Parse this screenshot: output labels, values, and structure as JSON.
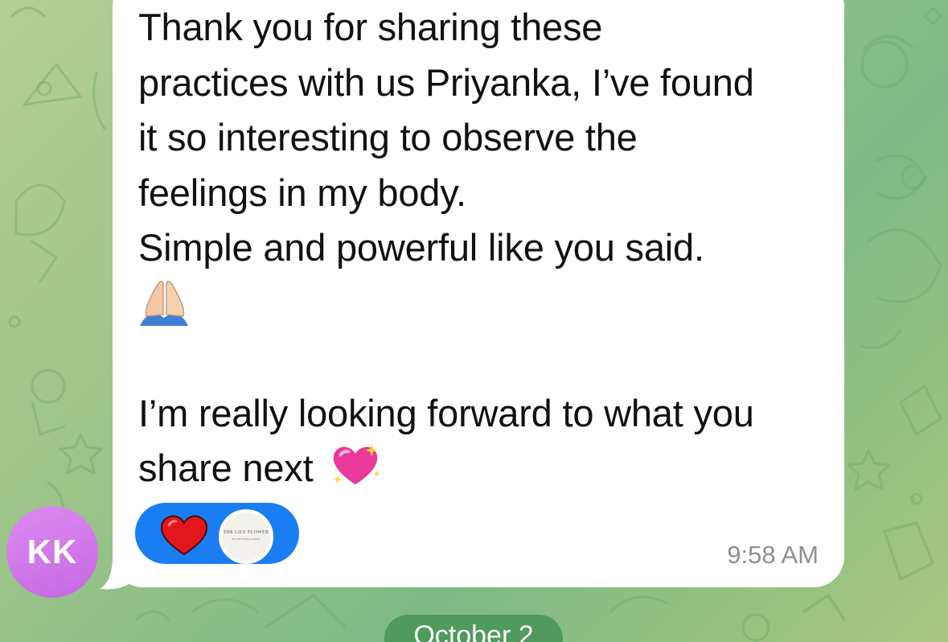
{
  "chat": {
    "message": {
      "lines": [
        "Thank you for sharing these",
        "practices with us Priyanka, I’ve found",
        "it so interesting to observe the",
        "feelings in my body.",
        "Simple and powerful like you said.",
        "",
        "",
        "I’m really looking forward to what you",
        "share next"
      ],
      "emoji_prayer": "pray-hands-icon",
      "emoji_sparkle_heart": "sparkling-heart-icon",
      "time": "9:58 AM",
      "reaction": {
        "emoji": "red-heart-icon",
        "reactor_avatar_text": "THE LILY FLOWER",
        "reactor_avatar_subtext": "BY PRIYANKA GAVAL"
      }
    },
    "sender": {
      "initials": "KK",
      "avatar_color": "#d07ae8"
    },
    "date_separator": "October 2"
  },
  "colors": {
    "bubble": "#ffffff",
    "reaction_pill": "#1a7df2",
    "wallpaper_start": "#b3cf94",
    "wallpaper_end": "#7fb985",
    "date_pill": "#4f9a5c"
  }
}
